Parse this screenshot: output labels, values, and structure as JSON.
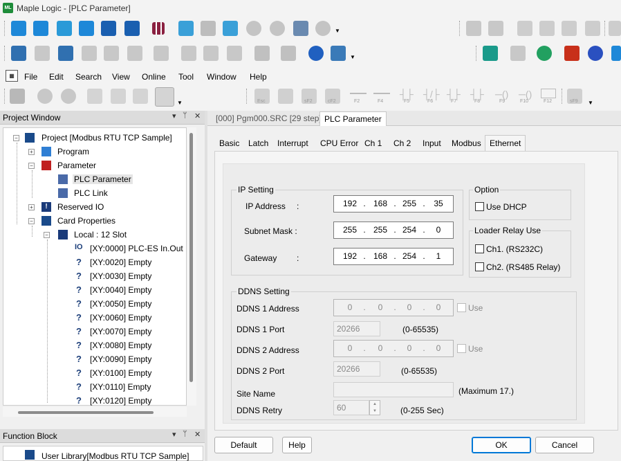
{
  "window": {
    "title": "Maple Logic - [PLC Parameter]",
    "app_icon_text": "ML"
  },
  "menu": [
    "File",
    "Edit",
    "Search",
    "View",
    "Online",
    "Tool",
    "Window",
    "Help"
  ],
  "toolbar3": [
    "Esc",
    "F2",
    "F3",
    "sF2",
    "cF2",
    "F2",
    "F4",
    "F5",
    "F6",
    "F7",
    "F8",
    "F9",
    "F10",
    "F12",
    "sF9"
  ],
  "project_window": {
    "title": "Project Window",
    "pin": "▼ ᛘ ✕",
    "items": [
      "Project [Modbus RTU TCP Sample]",
      "Program",
      "Parameter",
      "PLC Parameter",
      "PLC Link",
      "Reserved IO",
      "Card Properties",
      "Local : 12 Slot",
      "[XY:0000] PLC-ES In.Out",
      "[XY:0020] Empty",
      "[XY:0030] Empty",
      "[XY:0040] Empty",
      "[XY:0050] Empty",
      "[XY:0060] Empty",
      "[XY:0070] Empty",
      "[XY:0080] Empty",
      "[XY:0090] Empty",
      "[XY:0100] Empty",
      "[XY:0110] Empty",
      "[XY:0120] Empty"
    ]
  },
  "function_block": {
    "title": "Function Block",
    "item": "User Library[Modbus RTU TCP Sample]"
  },
  "doc_tabs": [
    "[000] Pgm000.SRC [29 step]",
    "PLC Parameter"
  ],
  "param_tabs": [
    "Basic",
    "Latch",
    "Interrupt",
    "CPU Error",
    "Ch 1",
    "Ch 2",
    "Input",
    "Modbus",
    "Ethernet"
  ],
  "ip_setting": {
    "title": "IP Setting",
    "ip_label": "IP Address",
    "ip": [
      "192",
      "168",
      "255",
      "35"
    ],
    "mask_label": "Subnet Mask :",
    "mask": [
      "255",
      "255",
      "254",
      "0"
    ],
    "gw_label": "Gateway",
    "gw": [
      "192",
      "168",
      "254",
      "1"
    ],
    "colon": ":"
  },
  "option": {
    "title": "Option",
    "dhcp": "Use DHCP"
  },
  "loader": {
    "title": "Loader Relay Use",
    "ch1": "Ch1. (RS232C)",
    "ch2": "Ch2. (RS485 Relay)"
  },
  "ddns": {
    "title": "DDNS Setting",
    "addr1_label": "DDNS 1 Address",
    "addr1": [
      "0",
      "0",
      "0",
      "0"
    ],
    "use": "Use",
    "port1_label": "DDNS 1 Port",
    "port1": "20266",
    "port_range": "(0-65535)",
    "addr2_label": "DDNS 2 Address",
    "addr2": [
      "0",
      "0",
      "0",
      "0"
    ],
    "port2_label": "DDNS 2 Port",
    "port2": "20266",
    "site_label": "Site Name",
    "site_hint": "(Maximum 17.)",
    "retry_label": "DDNS Retry",
    "retry": "60",
    "retry_range": "(0-255 Sec)"
  },
  "buttons": {
    "default": "Default",
    "help": "Help",
    "ok": "OK",
    "cancel": "Cancel"
  }
}
